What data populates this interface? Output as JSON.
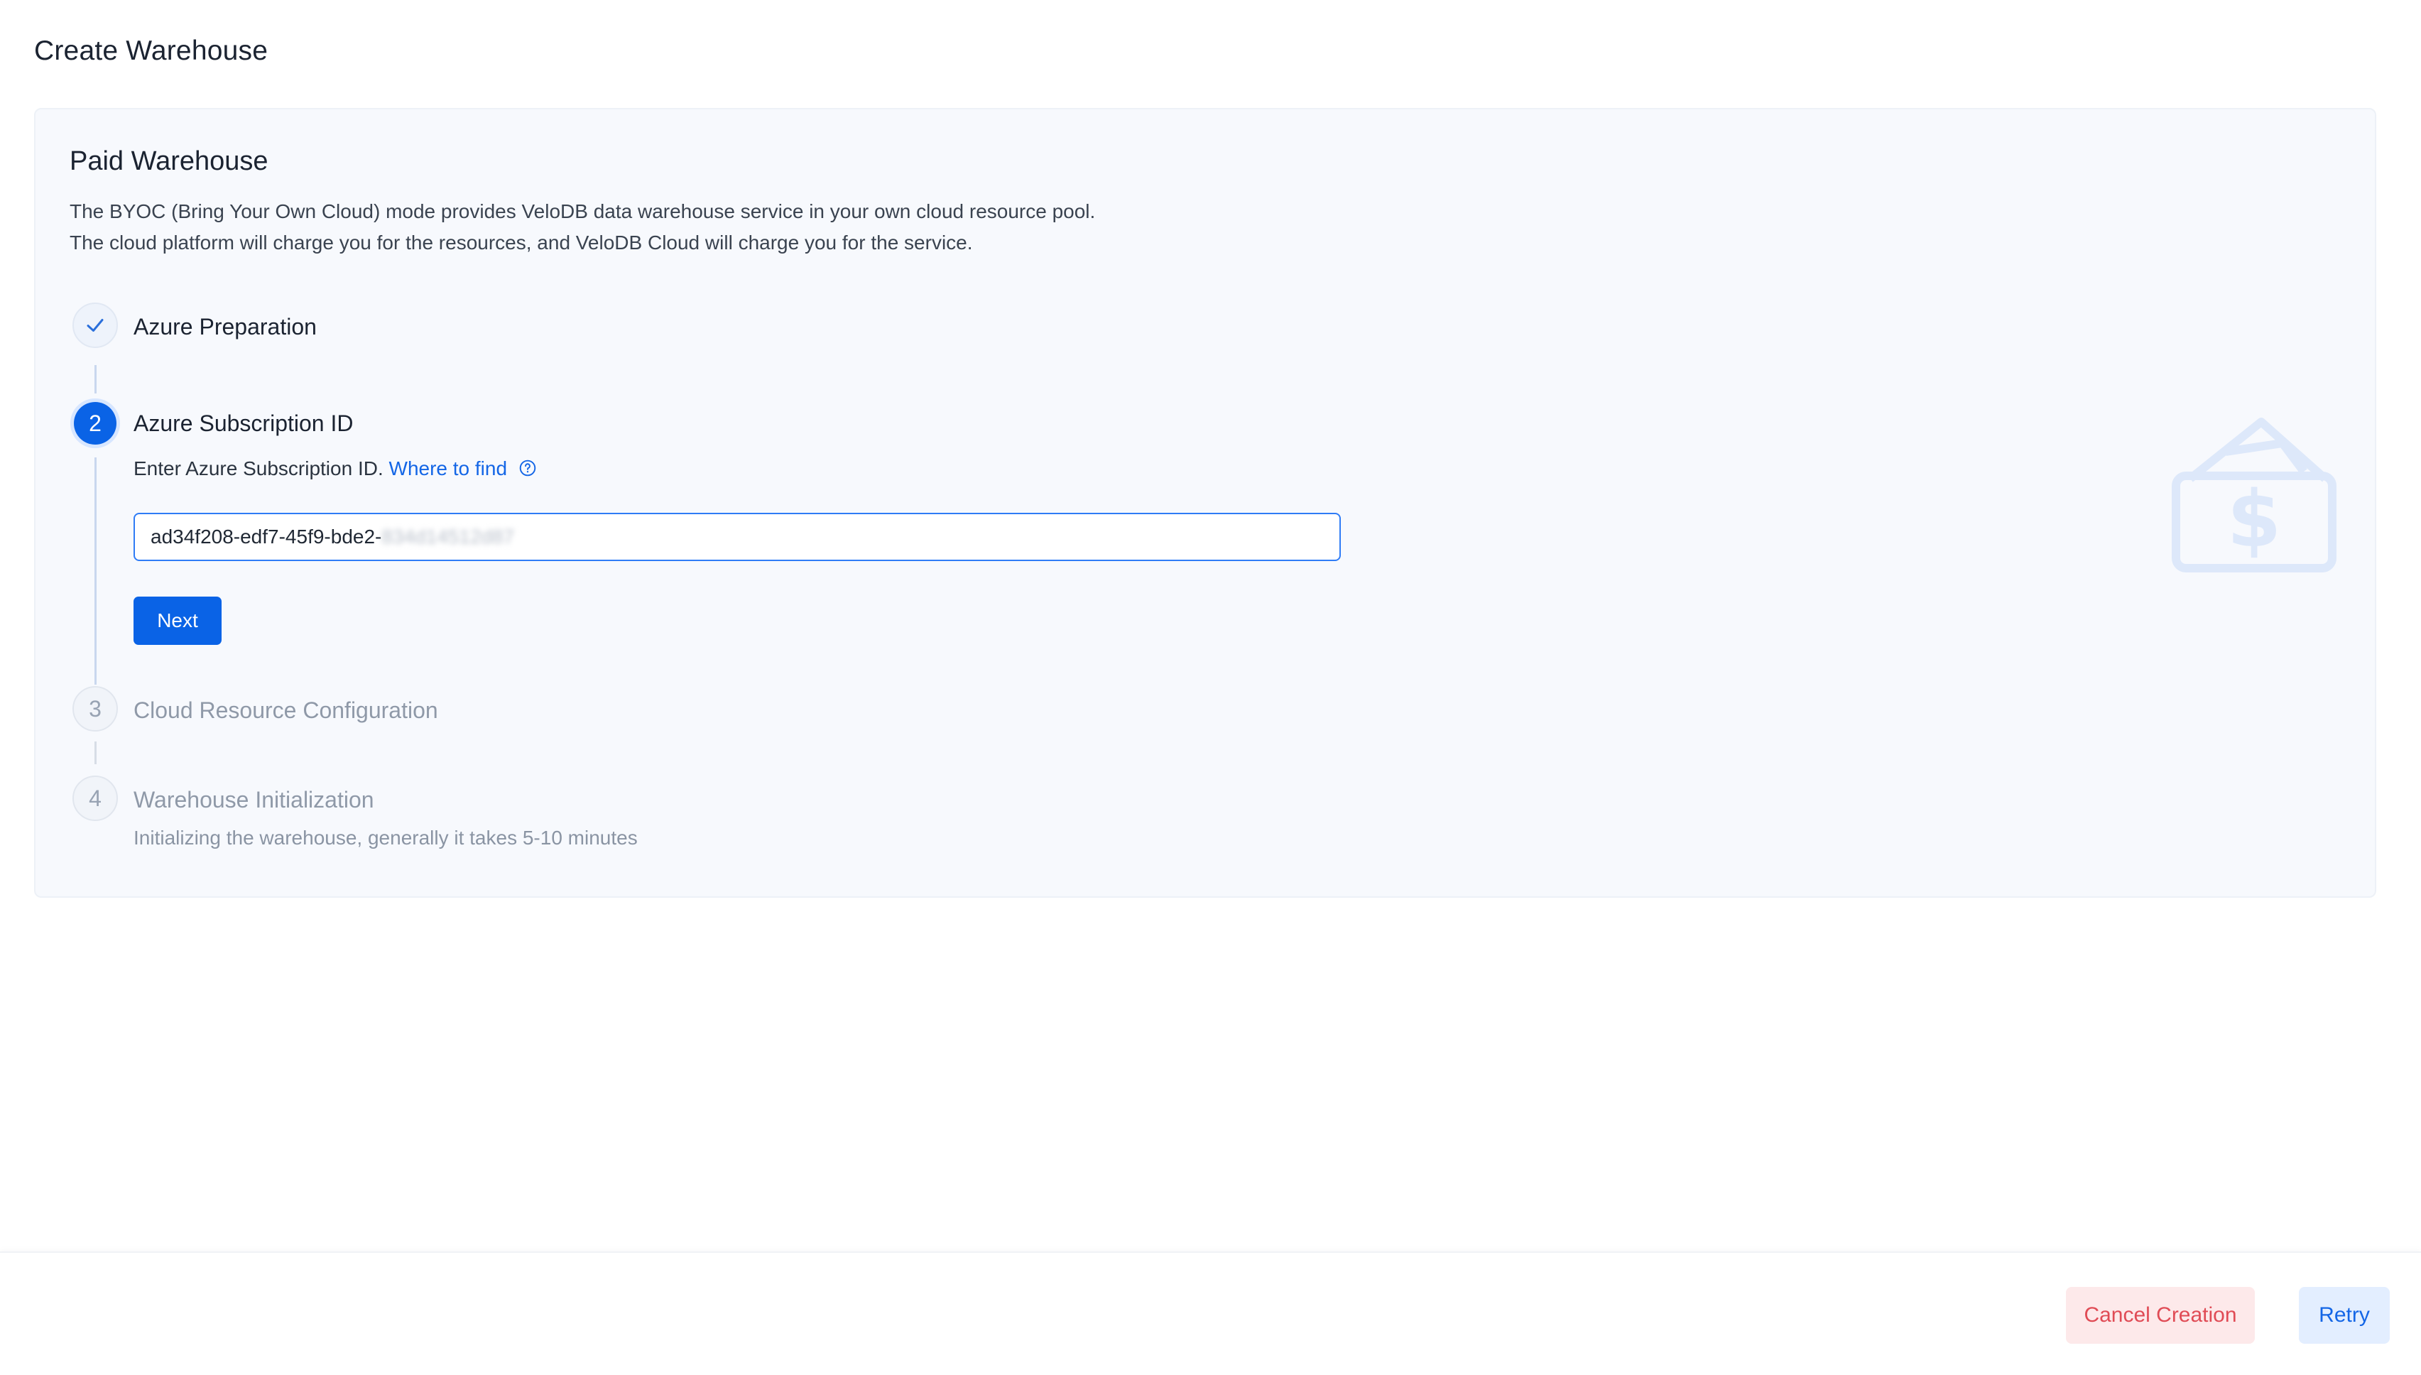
{
  "page": {
    "title": "Create Warehouse"
  },
  "card": {
    "title": "Paid Warehouse",
    "description_line1": "The BYOC (Bring Your Own Cloud) mode provides VeloDB data warehouse service in your own cloud resource pool.",
    "description_line2": "The cloud platform will charge you for the resources, and VeloDB Cloud will charge you for the service."
  },
  "steps": [
    {
      "number": "1",
      "title": "Azure Preparation",
      "status": "done",
      "icon": "check-icon"
    },
    {
      "number": "2",
      "title": "Azure Subscription ID",
      "status": "active",
      "hint": "Enter Azure Subscription ID.",
      "link": "Where to find",
      "input_value_visible": "ad34f208-edf7-45f9-bde2-",
      "input_value_blurred": "834d14512d87",
      "button": "Next"
    },
    {
      "number": "3",
      "title": "Cloud Resource Configuration",
      "status": "pending"
    },
    {
      "number": "4",
      "title": "Warehouse Initialization",
      "status": "pending",
      "subtitle": "Initializing the warehouse, generally it takes 5-10 minutes"
    }
  ],
  "footer": {
    "cancel_label": "Cancel Creation",
    "retry_label": "Retry"
  },
  "colors": {
    "primary": "#0a63e6",
    "danger": "#e04b55",
    "card_bg": "#f7f9fd"
  }
}
